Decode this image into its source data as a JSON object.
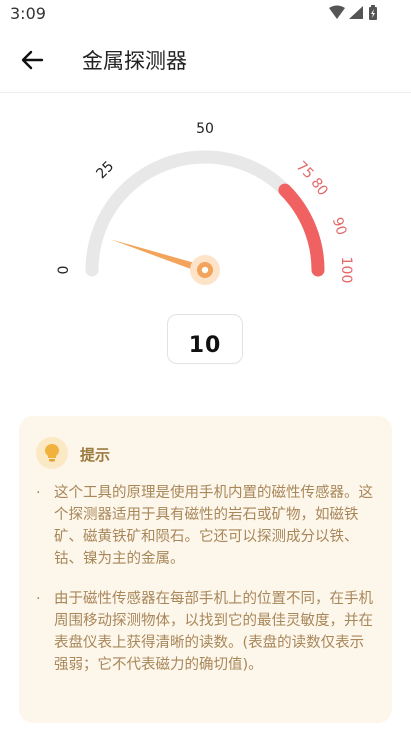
{
  "status": {
    "time": "3:09"
  },
  "app_bar": {
    "title": "金属探测器"
  },
  "gauge": {
    "min": 0,
    "max": 100,
    "value": 10,
    "display_value": "10",
    "ticks": [
      {
        "label": "0",
        "value": 0,
        "warning": false
      },
      {
        "label": "25",
        "value": 25,
        "warning": false
      },
      {
        "label": "50",
        "value": 50,
        "warning": false
      },
      {
        "label": "75",
        "value": 75,
        "warning": true
      },
      {
        "label": "80",
        "value": 80,
        "warning": true
      },
      {
        "label": "90",
        "value": 90,
        "warning": true
      },
      {
        "label": "100",
        "value": 100,
        "warning": true
      }
    ],
    "warning_start": 75,
    "colors": {
      "track": "#e8e8e8",
      "warning": "#f06262",
      "needle": "#f3a35a",
      "tick_normal": "#222222",
      "tick_warning": "#e26a6a"
    }
  },
  "tips": {
    "title": "提示",
    "items": [
      {
        "bullet": "·",
        "text": "这个工具的原理是使用手机内置的磁性传感器。这个探测器适用于具有磁性的岩石或矿物，如磁铁矿、磁黄铁矿和陨石。它还可以探测成分以铁、钴、镍为主的金属。"
      },
      {
        "bullet": "·",
        "text": "由于磁性传感器在每部手机上的位置不同，在手机周围移动探测物体，以找到它的最佳灵敏度，并在表盘仪表上获得清晰的读数。(表盘的读数仅表示强弱；它不代表磁力的确切值)。"
      }
    ],
    "colors": {
      "background": "#fdf6ea",
      "text": "#a8875a"
    }
  },
  "icons": {
    "back": "arrow-left-icon",
    "wifi": "wifi-icon",
    "signal": "cell-signal-icon",
    "battery": "battery-icon",
    "tip": "lightbulb-icon"
  }
}
